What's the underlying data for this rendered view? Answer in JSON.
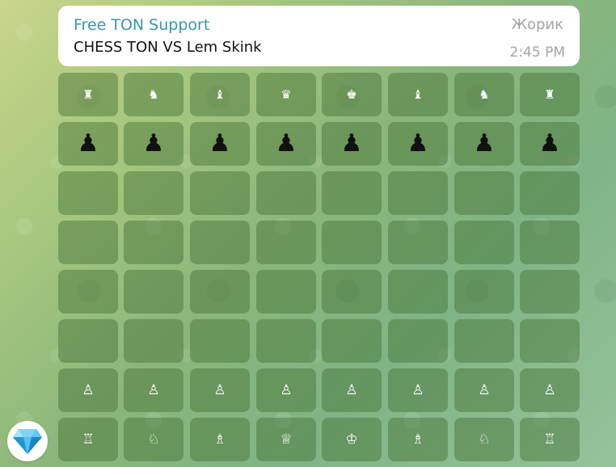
{
  "message": {
    "sender": "Free TON Support",
    "author": "Жорик",
    "text": "CHESS TON VS Lem Skink",
    "time": "2:45 PM"
  },
  "board": {
    "rows": [
      [
        "♜",
        "♞",
        "♝",
        "♛",
        "♚",
        "♝",
        "♞",
        "♜"
      ],
      [
        "♟",
        "♟",
        "♟",
        "♟",
        "♟",
        "♟",
        "♟",
        "♟"
      ],
      [
        "",
        "",
        "",
        "",
        "",
        "",
        "",
        ""
      ],
      [
        "",
        "",
        "",
        "",
        "",
        "",
        "",
        ""
      ],
      [
        "",
        "",
        "",
        "",
        "",
        "",
        "",
        ""
      ],
      [
        "",
        "",
        "",
        "",
        "",
        "",
        "",
        ""
      ],
      [
        "♙",
        "♙",
        "♙",
        "♙",
        "♙",
        "♙",
        "♙",
        "♙"
      ],
      [
        "♖",
        "♘",
        "♗",
        "♕",
        "♔",
        "♗",
        "♘",
        "♖"
      ]
    ]
  },
  "avatar": {
    "icon": "diamond-icon",
    "color": "#2aa8e8"
  }
}
